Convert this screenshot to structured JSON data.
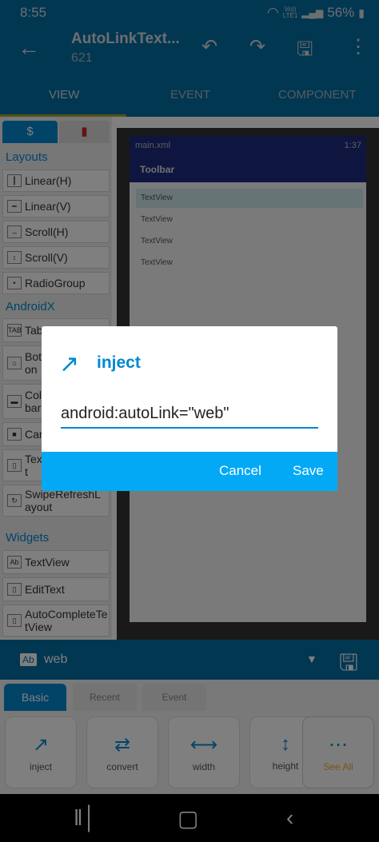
{
  "status_bar": {
    "time": "8:55",
    "network_top": "Vo))",
    "network_bottom": "LTE1",
    "battery": "56%"
  },
  "app_bar": {
    "title": "AutoLinkText...",
    "subtitle": "621"
  },
  "main_tabs": [
    {
      "label": "VIEW"
    },
    {
      "label": "EVENT"
    },
    {
      "label": "COMPONENT"
    }
  ],
  "palette": {
    "tab_icons": [
      "$",
      "bookmark"
    ],
    "sections": [
      {
        "title": "Layouts"
      },
      {
        "title": "AndroidX"
      },
      {
        "title": "Widgets"
      }
    ],
    "layouts": [
      "Linear(H)",
      "Linear(V)",
      "Scroll(H)",
      "Scroll(V)",
      "RadioGroup"
    ],
    "androidx": [
      "Tab",
      "Bot\non",
      "Col\nbar",
      "Car",
      "Tex\nt",
      "SwipeRefreshL\nayout"
    ],
    "widgets": [
      "TextView",
      "EditText",
      "AutoCompleteTe\ntView"
    ]
  },
  "preview": {
    "file": "main.xml",
    "clock": "1:37",
    "toolbar": "Toolbar",
    "textviews": [
      "TextView",
      "TextView",
      "TextView",
      "TextView"
    ]
  },
  "selection": {
    "badge": "Ab",
    "value": "web"
  },
  "property_tabs": [
    {
      "label": "Basic"
    },
    {
      "label": "Recent"
    },
    {
      "label": "Event"
    }
  ],
  "tools": [
    {
      "label": "inject"
    },
    {
      "label": "convert"
    },
    {
      "label": "width"
    },
    {
      "label": "height"
    },
    {
      "label": "See All"
    }
  ],
  "dialog": {
    "title": "inject",
    "input_value": "android:autoLink=\"web\"",
    "cancel_label": "Cancel",
    "save_label": "Save"
  },
  "colors": {
    "primary": "#046fa4",
    "accent": "#03a9f4",
    "toolbar_preview": "#1c2c80"
  }
}
